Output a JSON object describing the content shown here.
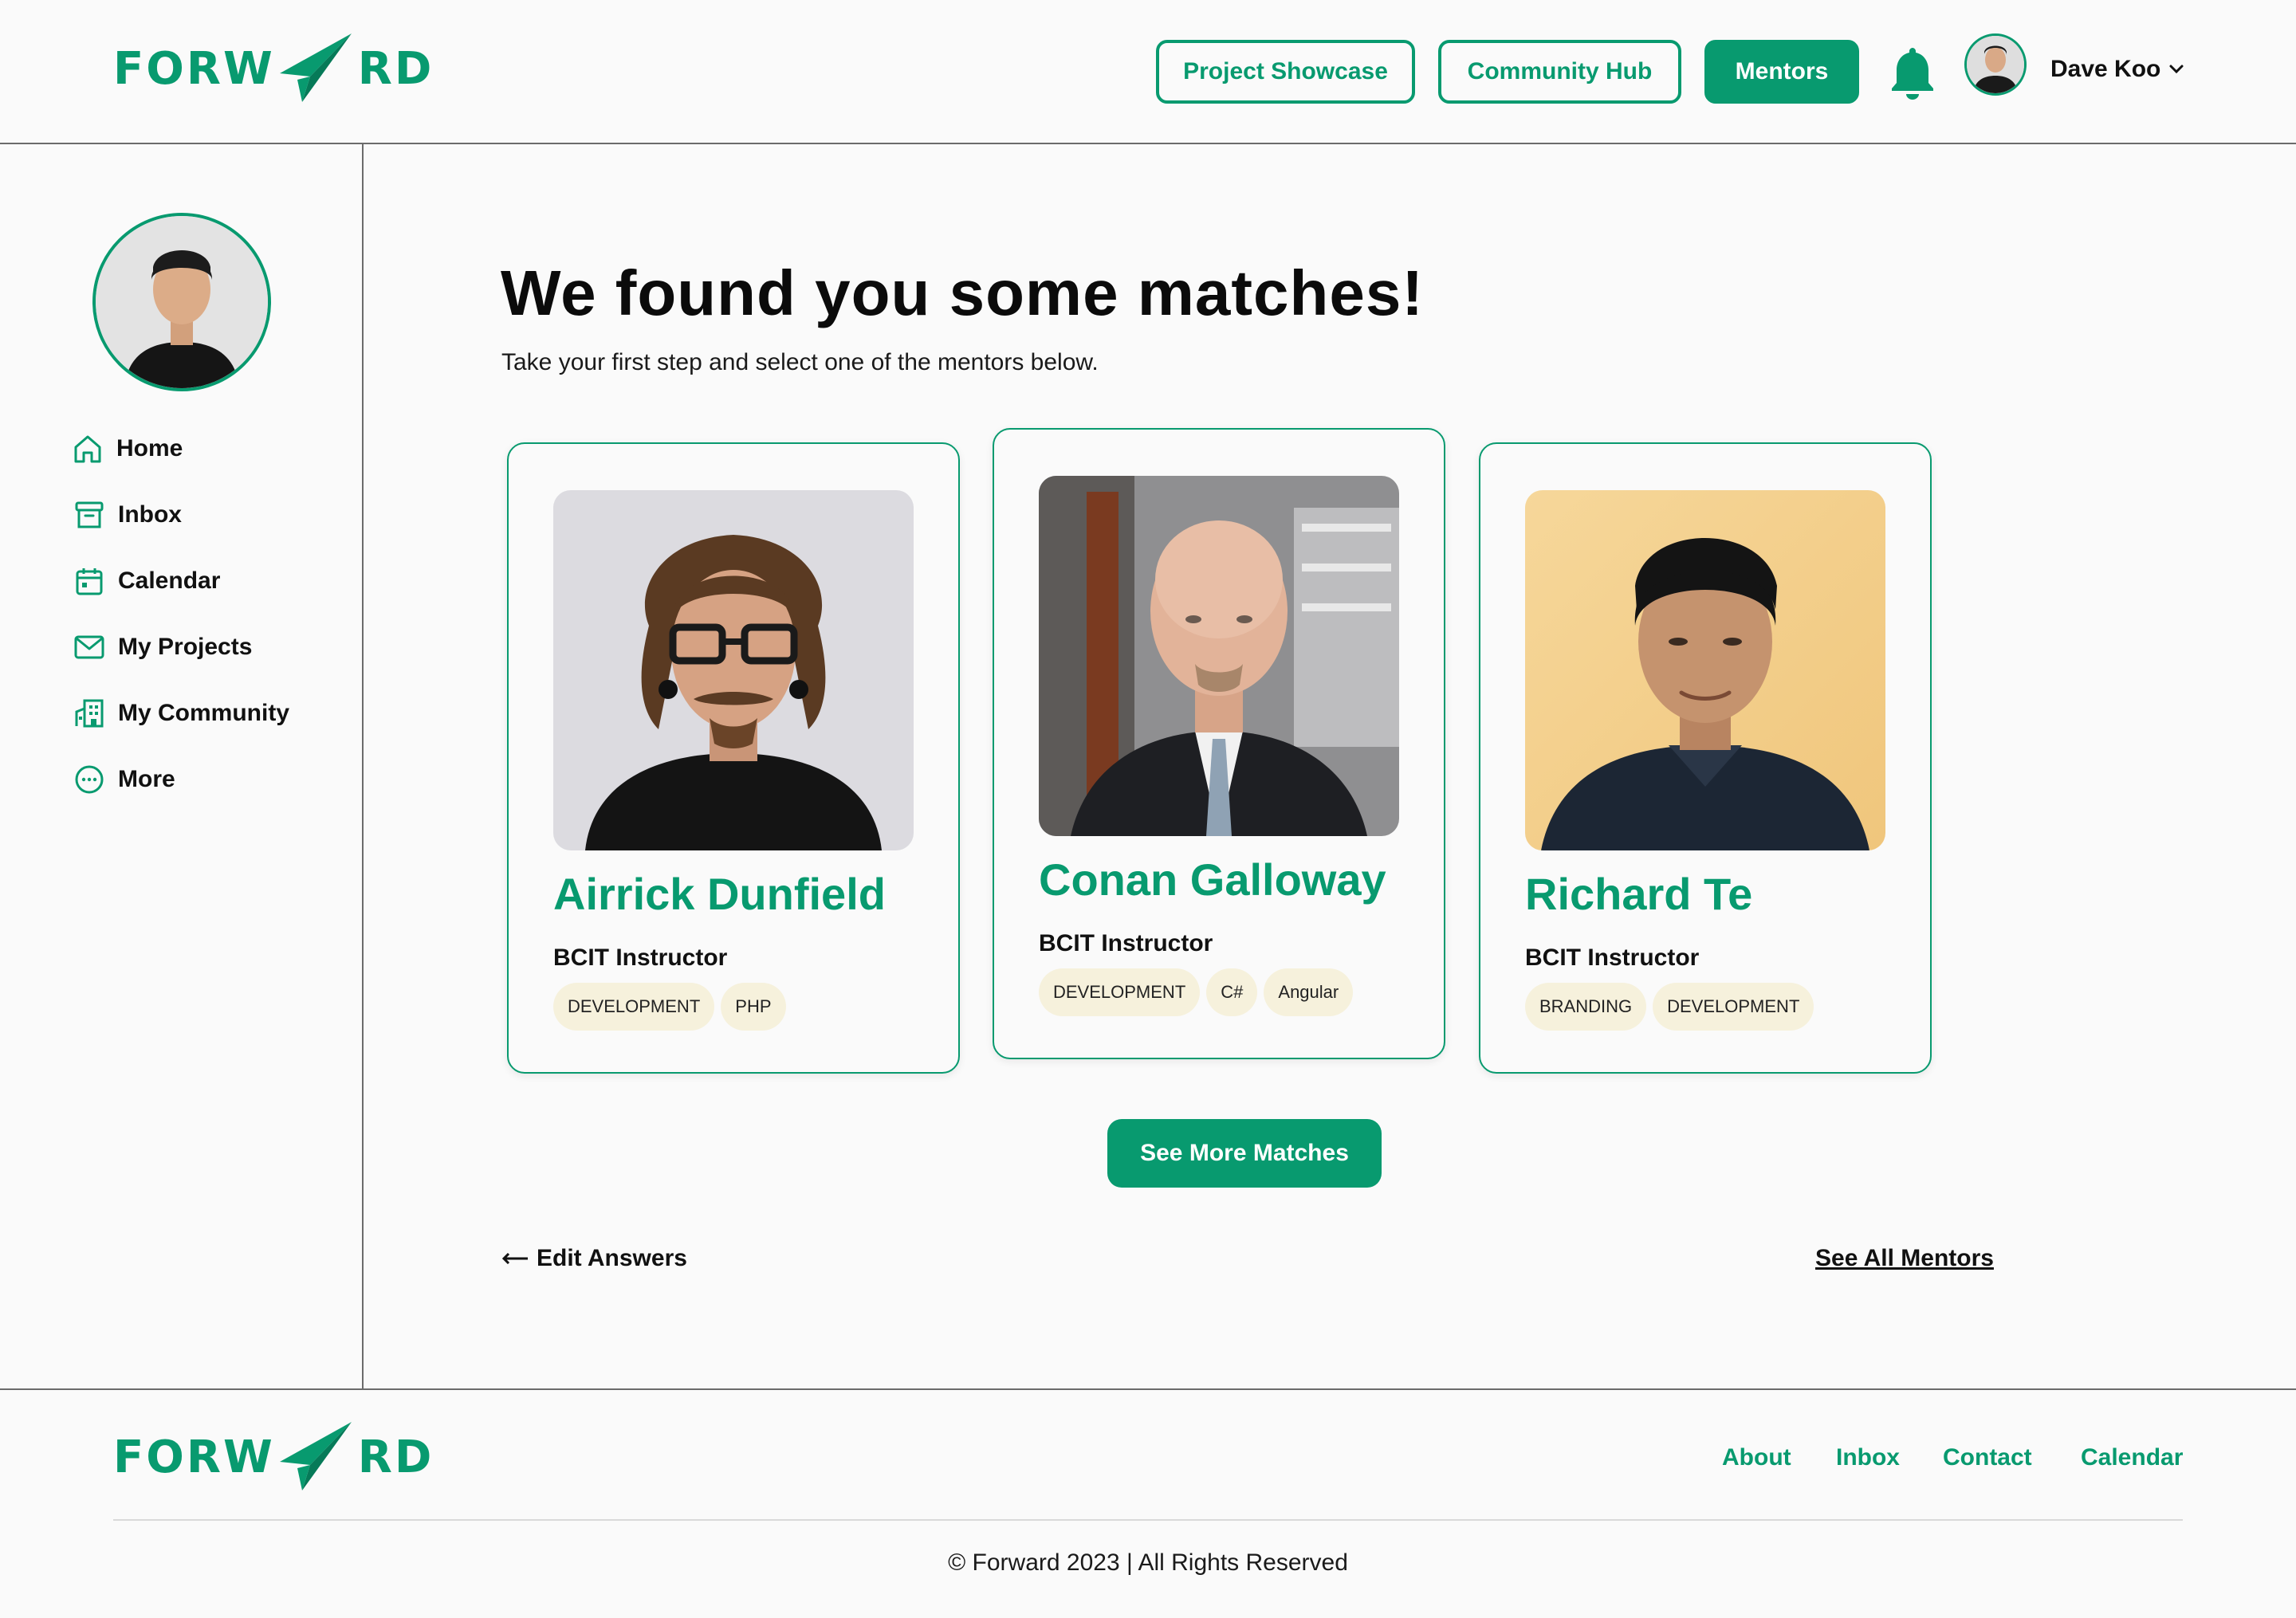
{
  "brand": {
    "logo_left": "FORW",
    "logo_right": "RD",
    "accent_color": "#089a6f",
    "tag_color": "#f6f1dc"
  },
  "header": {
    "nav": [
      {
        "label": "Project Showcase",
        "active": false
      },
      {
        "label": "Community Hub",
        "active": false
      },
      {
        "label": "Mentors",
        "active": true
      }
    ],
    "notification_icon": "bell-icon",
    "user": {
      "name": "Dave Koo",
      "menu_icon": "chevron-down-icon"
    }
  },
  "sidebar": {
    "items": [
      {
        "label": "Home",
        "icon": "home-icon"
      },
      {
        "label": "Inbox",
        "icon": "archive-icon"
      },
      {
        "label": "Calendar",
        "icon": "calendar-icon"
      },
      {
        "label": "My Projects",
        "icon": "mail-icon"
      },
      {
        "label": "My Community",
        "icon": "building-icon"
      },
      {
        "label": "More",
        "icon": "more-icon"
      }
    ]
  },
  "main": {
    "title": "We found you some matches!",
    "subtitle": "Take your first step and select one of the mentors below.",
    "mentors": [
      {
        "name": "Airrick Dunfield",
        "role": "BCIT Instructor",
        "tags": [
          "DEVELOPMENT",
          "PHP"
        ]
      },
      {
        "name": "Conan Galloway",
        "role": "BCIT Instructor",
        "tags": [
          "DEVELOPMENT",
          "C#",
          "Angular"
        ]
      },
      {
        "name": "Richard Te",
        "role": "BCIT Instructor",
        "tags": [
          "BRANDING",
          "DEVELOPMENT"
        ]
      }
    ],
    "see_more_label": "See More Matches",
    "edit_answers_label": "Edit Answers",
    "see_all_label": "See All Mentors"
  },
  "footer": {
    "links": [
      "About",
      "Inbox",
      "Contact",
      "Calendar"
    ],
    "copyright": "© Forward 2023 | All Rights Reserved"
  }
}
